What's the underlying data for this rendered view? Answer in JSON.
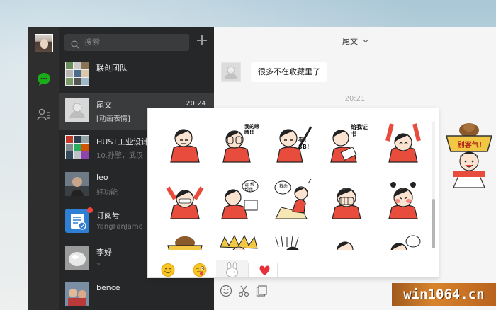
{
  "colors": {
    "rail_bg": "#2e2e2e",
    "list_bg": "#262728",
    "active_row": "#3a3b3c",
    "accent_green": "#1aad19",
    "unread_red": "#f44336"
  },
  "nav": {
    "items": [
      {
        "icon": "chat-bubble-icon",
        "active": true
      },
      {
        "icon": "contacts-icon",
        "active": false
      }
    ]
  },
  "search": {
    "placeholder": "搜索"
  },
  "conversations": [
    {
      "name": "联创团队",
      "preview": "",
      "time": ""
    },
    {
      "name": "尾文",
      "preview": "[动画表情]",
      "time": "20:24",
      "active": true
    },
    {
      "name": "HUST工业设计系",
      "preview": "10.孙擎，武汉",
      "time": ""
    },
    {
      "name": "leo",
      "preview": "好功能",
      "time": ""
    },
    {
      "name": "订阅号",
      "preview": "YangFanJame",
      "time": "",
      "unread": true
    },
    {
      "name": "李好",
      "preview": "？",
      "time": ""
    },
    {
      "name": "bence",
      "preview": "",
      "time": ""
    }
  ],
  "chat": {
    "title": "尾文",
    "messages": [
      {
        "text": "很多不在收藏里了"
      }
    ],
    "timestamp": "20:21"
  },
  "sticker_panel": {
    "tabs": [
      {
        "icon": "smiley-emoji-icon"
      },
      {
        "icon": "tongue-emoji-icon"
      },
      {
        "icon": "bunny-sticker-icon",
        "selected": true
      },
      {
        "icon": "heart-favorites-icon"
      }
    ],
    "stickers": [
      {
        "caption": ""
      },
      {
        "caption": "我的眼睛!!"
      },
      {
        "caption": "看! SB!"
      },
      {
        "caption": "给我证书"
      },
      {
        "caption": ""
      },
      {
        "caption": ""
      },
      {
        "caption": "请 帮帮我"
      },
      {
        "caption": "救命"
      },
      {
        "caption": ""
      },
      {
        "caption": ""
      }
    ]
  },
  "right_sticker": {
    "caption": "别客气!"
  },
  "toolbar": {
    "icons": [
      "emoji-icon",
      "scissors-icon",
      "folder-icon"
    ]
  },
  "watermark": {
    "text": "win1064.cn"
  }
}
